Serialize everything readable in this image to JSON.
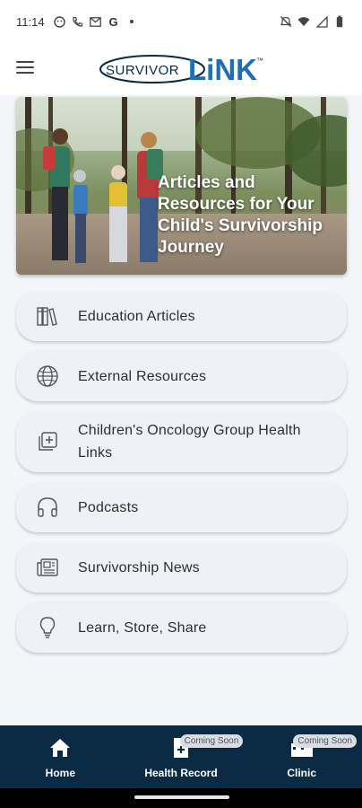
{
  "status_bar": {
    "time": "11:14",
    "left_icons": [
      "face-icon",
      "call-icon",
      "gmail-icon",
      "google-icon",
      "dot-icon"
    ],
    "google_letter": "G",
    "right_icons": [
      "mute-icon",
      "wifi-icon",
      "signal-icon",
      "battery-icon"
    ]
  },
  "header": {
    "logo_text_left": "SURVIVOR",
    "logo_text_right": "LiNK",
    "logo_tm": "™"
  },
  "hero": {
    "title": "Articles and Resources for Your Child's Survivorship Journey"
  },
  "menu": {
    "items": [
      {
        "label": "Education Articles",
        "icon": "books-icon"
      },
      {
        "label": "External Resources",
        "icon": "globe-icon"
      },
      {
        "label": "Children's Oncology Group Health Links",
        "icon": "health-links-icon"
      },
      {
        "label": "Podcasts",
        "icon": "headphones-icon"
      },
      {
        "label": "Survivorship News",
        "icon": "newspaper-icon"
      },
      {
        "label": "Learn, Store, Share",
        "icon": "lightbulb-icon"
      }
    ]
  },
  "bottom_nav": {
    "items": [
      {
        "label": "Home",
        "icon": "home-icon",
        "badge": ""
      },
      {
        "label": "Health Record",
        "icon": "health-record-icon",
        "badge": "Coming Soon"
      },
      {
        "label": "Clinic",
        "icon": "clinic-icon",
        "badge": "Coming Soon"
      }
    ]
  },
  "colors": {
    "nav_background": "#0b2a44",
    "content_background": "#f3f5f9",
    "card_background": "#eef1f6",
    "logo_blue": "#1f6fb5",
    "logo_navy": "#0b2a44"
  }
}
